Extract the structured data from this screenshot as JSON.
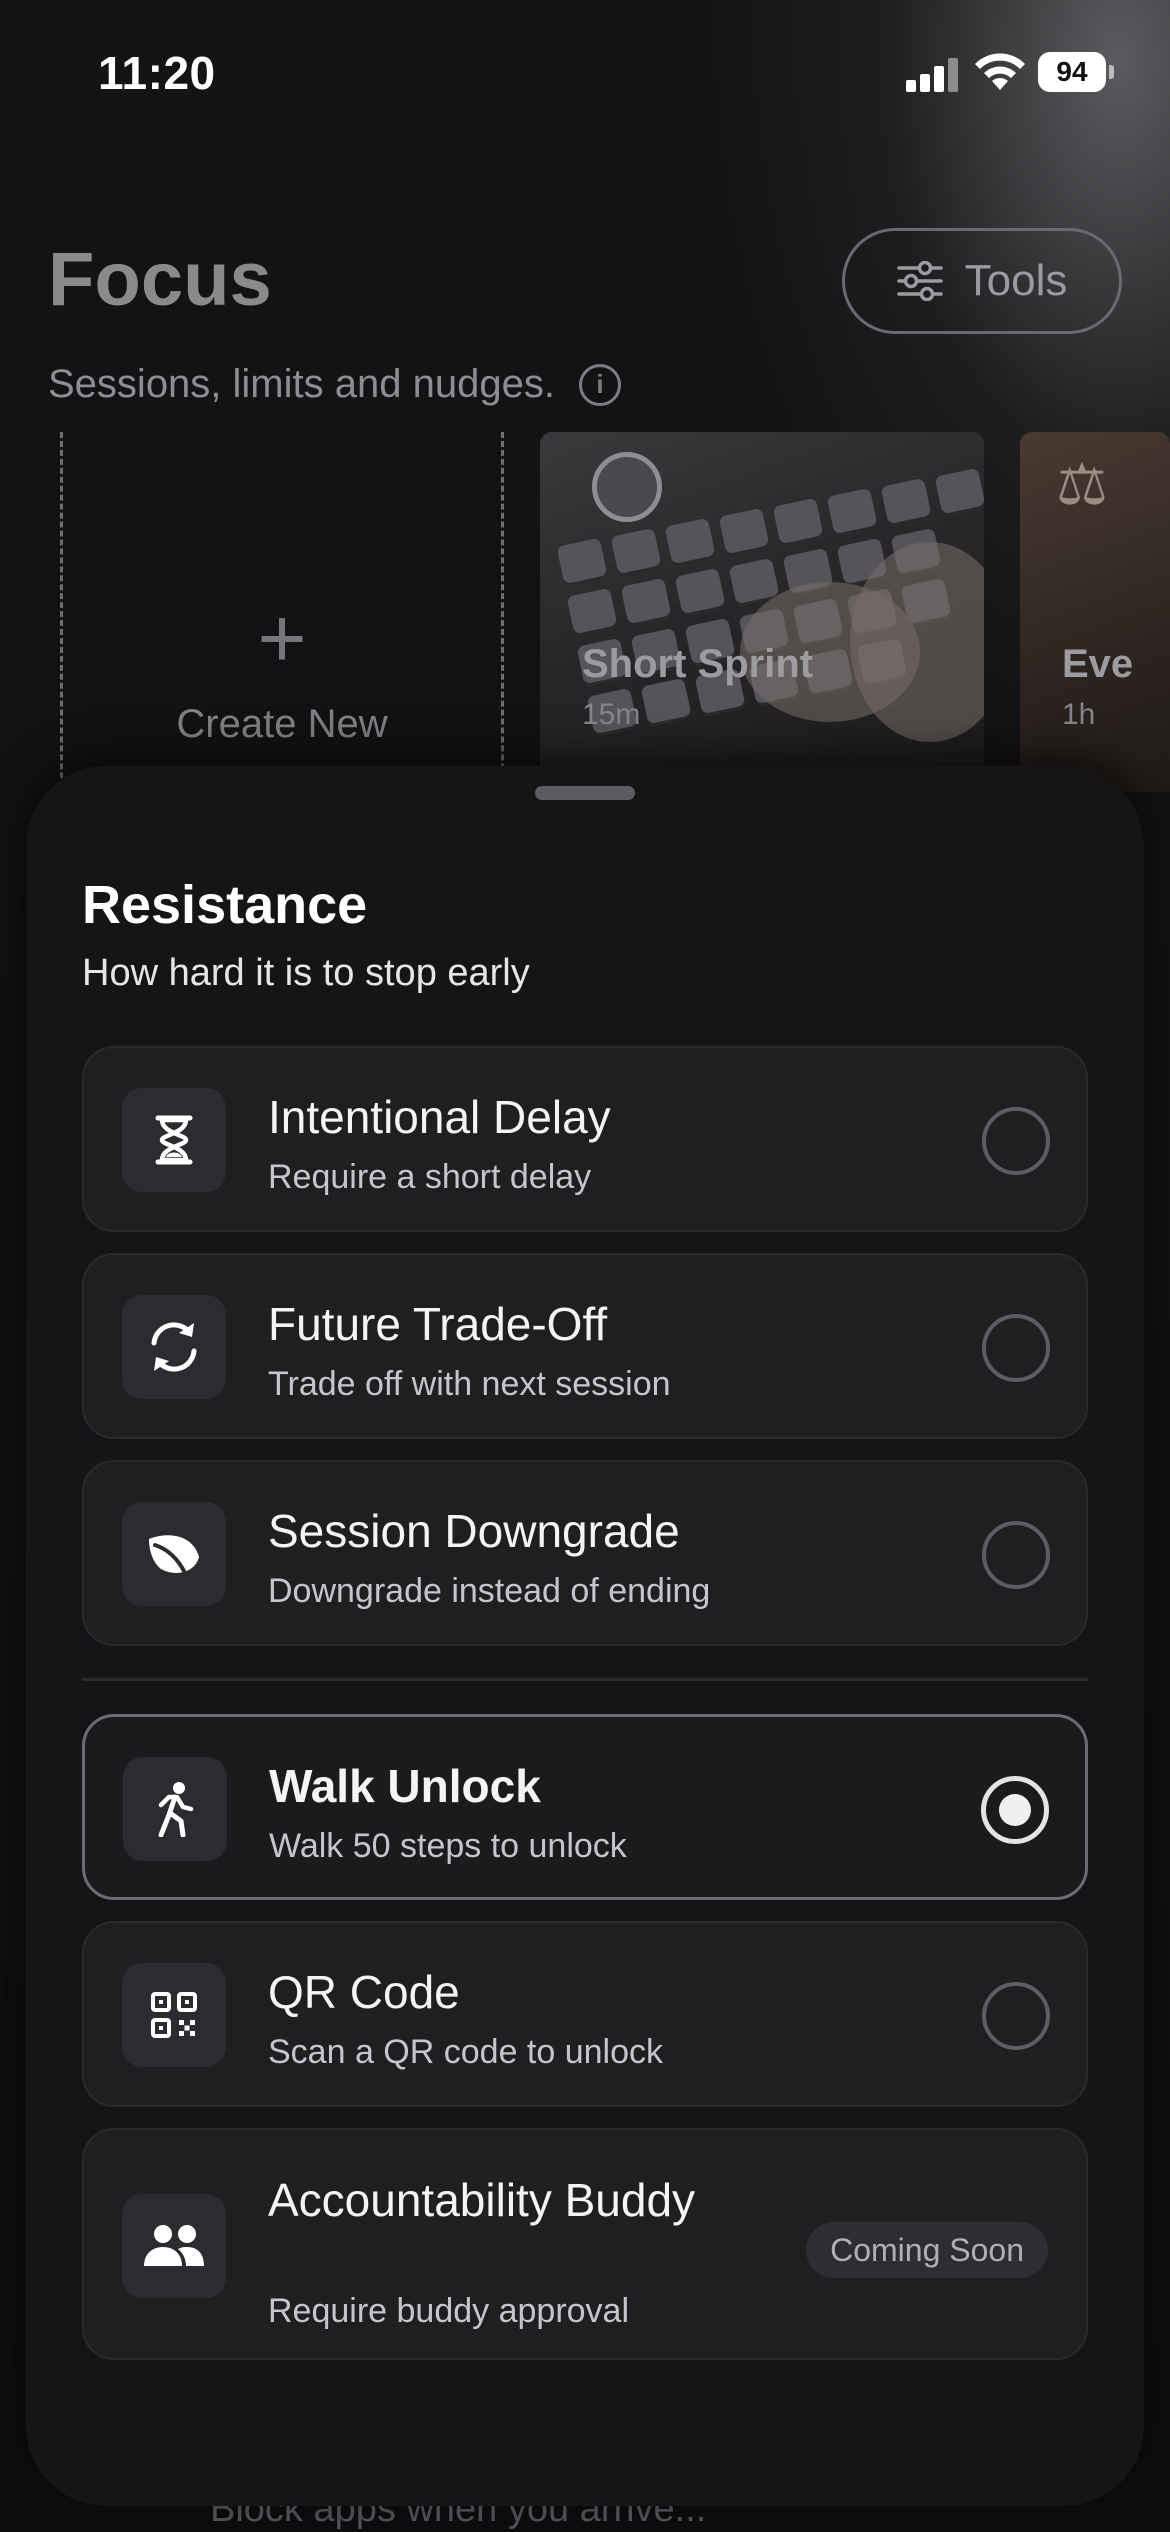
{
  "status_bar": {
    "time": "11:20",
    "battery": "94"
  },
  "header": {
    "title": "Focus",
    "tools_label": "Tools",
    "subtitle": "Sessions, limits and nudges."
  },
  "templates": [
    {
      "label": "Create New"
    },
    {
      "title": "Short Sprint",
      "duration": "15m"
    },
    {
      "title": "Eve",
      "duration": "1h"
    }
  ],
  "sheet": {
    "title": "Resistance",
    "subtitle": "How hard it is to stop early",
    "options": [
      {
        "title": "Intentional Delay",
        "desc": "Require a short delay",
        "icon": "hourglass-icon",
        "selected": false
      },
      {
        "title": "Future Trade-Off",
        "desc": "Trade off with next session",
        "icon": "sync-icon",
        "selected": false
      },
      {
        "title": "Session Downgrade",
        "desc": "Downgrade instead of ending",
        "icon": "leaf-icon",
        "selected": false
      },
      {
        "title": "Walk Unlock",
        "desc": "Walk 50 steps to unlock",
        "icon": "walking-icon",
        "selected": true
      },
      {
        "title": "QR Code",
        "desc": "Scan a QR code to unlock",
        "icon": "qr-code-icon",
        "selected": false
      },
      {
        "title": "Accountability Buddy",
        "desc": "Require buddy approval",
        "icon": "people-icon",
        "badge": "Coming Soon"
      }
    ]
  },
  "below_sheet_text": "Block apps when you arrive...",
  "colors": {
    "background": "#0c0c0e",
    "sheet": "#151517",
    "card": "#1f1f22",
    "selected_border": "#6c6c70"
  }
}
